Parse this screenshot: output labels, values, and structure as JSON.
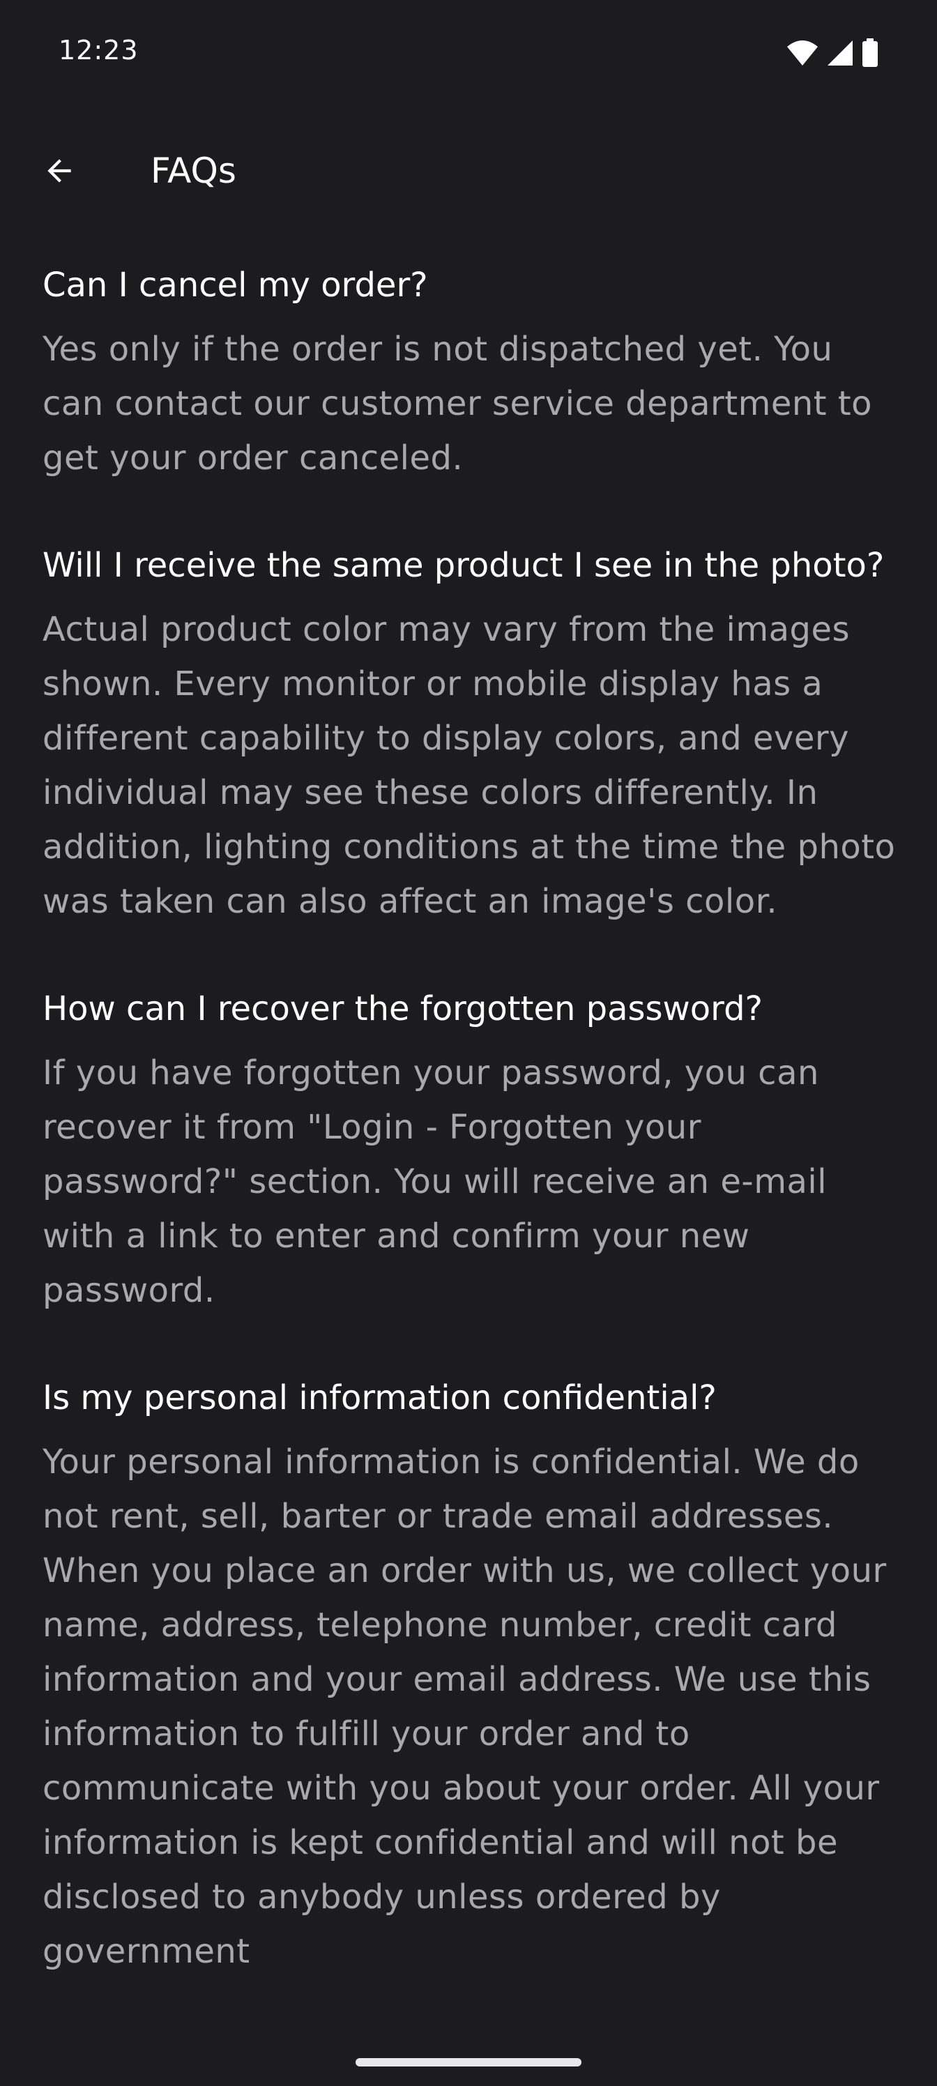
{
  "status_bar": {
    "time": "12:23",
    "icons": [
      "wifi-icon",
      "signal-icon",
      "battery-icon"
    ]
  },
  "app_bar": {
    "back_icon": "arrow-back-icon",
    "title": "FAQs"
  },
  "faqs": [
    {
      "question": "Can I cancel my order?",
      "answer": "Yes only if the order is not dispatched yet. You can contact our customer service department to get your order canceled."
    },
    {
      "question": "Will I receive the same product I see in the photo?",
      "answer": "Actual product color may vary from the images shown. Every monitor or mobile display has a different capability to display colors, and every individual may see these colors differently. In addition, lighting conditions at the time the photo was taken can also affect an image's color."
    },
    {
      "question": "How can I recover the forgotten password?",
      "answer": "If you have forgotten your password, you can recover it from \"Login - Forgotten your password?\" section. You will receive an e-mail with a link to enter and confirm your new password."
    },
    {
      "question": "Is my personal information confidential?",
      "answer": "Your personal information is confidential. We do not rent, sell, barter or trade email addresses. When you place an order with us, we collect your name, address, telephone number, credit card information and your email address. We use this information to fulfill your order and to communicate with you about your order. All your information is kept confidential and will not be disclosed to anybody unless ordered by government"
    }
  ],
  "colors": {
    "background": "#1c1b1d",
    "question_text": "#ffffff",
    "answer_text": "#a9a8ab"
  }
}
